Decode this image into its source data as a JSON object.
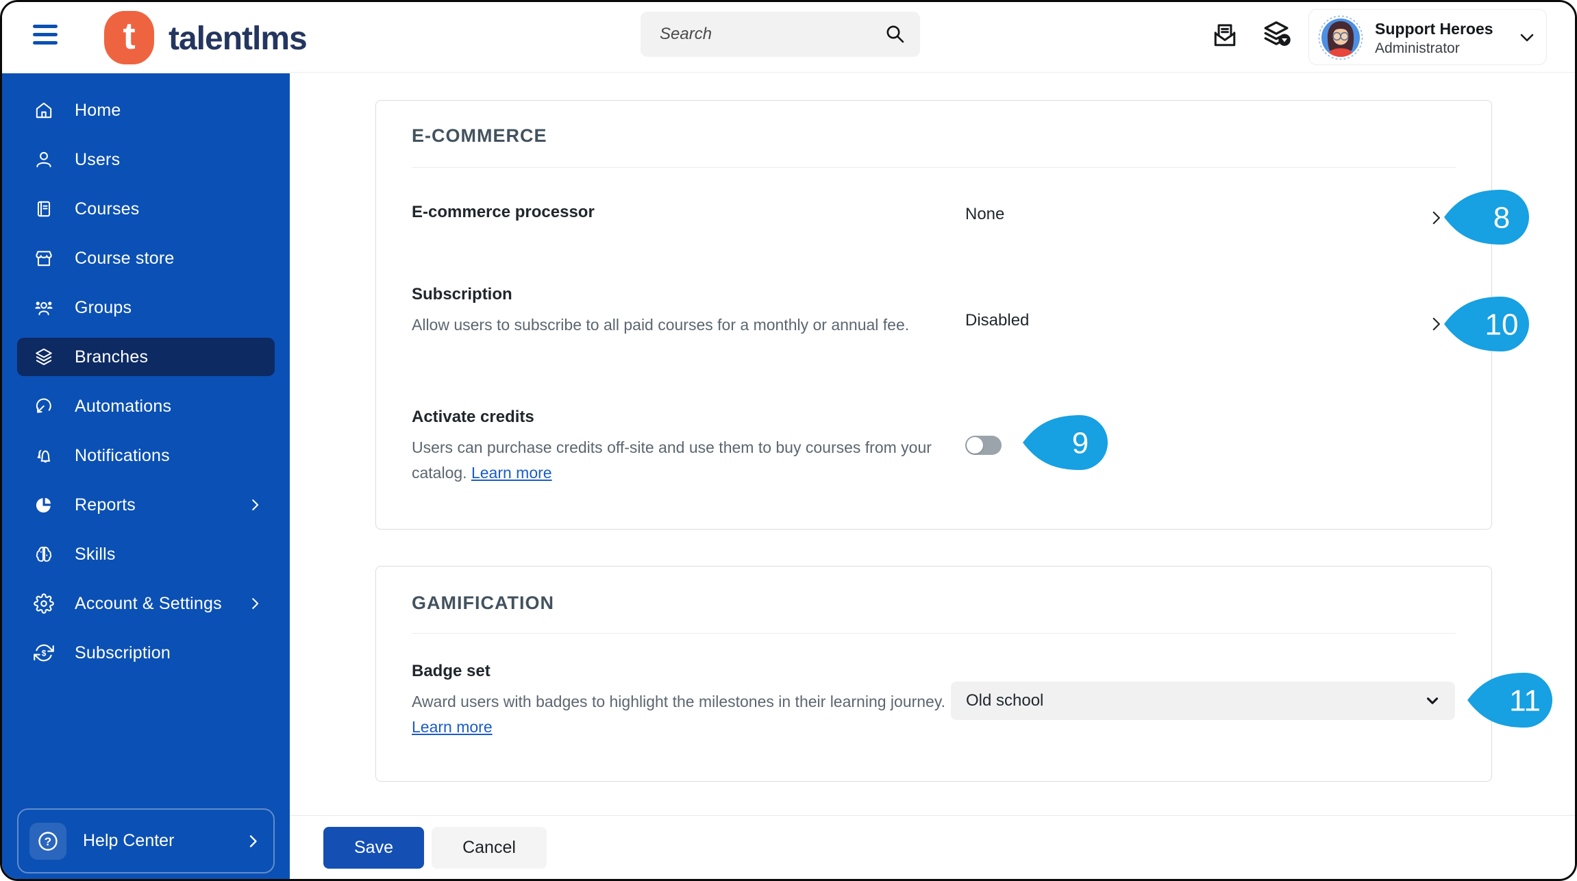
{
  "topbar": {
    "brand": "talentlms",
    "brand_initial": "t",
    "search_placeholder": "Search",
    "profile": {
      "name": "Support Heroes",
      "role": "Administrator"
    }
  },
  "sidebar": {
    "items": [
      {
        "label": "Home"
      },
      {
        "label": "Users"
      },
      {
        "label": "Courses"
      },
      {
        "label": "Course store"
      },
      {
        "label": "Groups"
      },
      {
        "label": "Branches"
      },
      {
        "label": "Automations"
      },
      {
        "label": "Notifications"
      },
      {
        "label": "Reports"
      },
      {
        "label": "Skills"
      },
      {
        "label": "Account & Settings"
      },
      {
        "label": "Subscription"
      }
    ],
    "selected_item": "Branches",
    "help_label": "Help Center"
  },
  "ecommerce": {
    "title": "E-COMMERCE",
    "processor_label": "E-commerce processor",
    "processor_value": "None",
    "subscription_label": "Subscription",
    "subscription_desc": "Allow users to subscribe to all paid courses for a monthly or annual fee.",
    "subscription_value": "Disabled",
    "credits_label": "Activate credits",
    "credits_desc": "Users can purchase credits off-site and use them to buy courses from your catalog.",
    "credits_link": "Learn more",
    "credits_toggle_state": "off"
  },
  "gamification": {
    "title": "GAMIFICATION",
    "badge_label": "Badge set",
    "badge_desc": "Award users with badges to highlight the milestones in their learning journey.",
    "badge_link": "Learn more",
    "badge_value": "Old school"
  },
  "actions": {
    "save": "Save",
    "cancel": "Cancel"
  },
  "callouts": {
    "c8": "8",
    "c9": "9",
    "c10": "10",
    "c11": "11"
  },
  "colors": {
    "sidebar_blue": "#0b50b4",
    "selected_navy": "#0d2a63",
    "logo_orange": "#ee6440",
    "brand_navy": "#24365f",
    "callout_blue": "#17a0e2",
    "save_blue": "#1450b4",
    "link_blue": "#1a5cc8"
  }
}
